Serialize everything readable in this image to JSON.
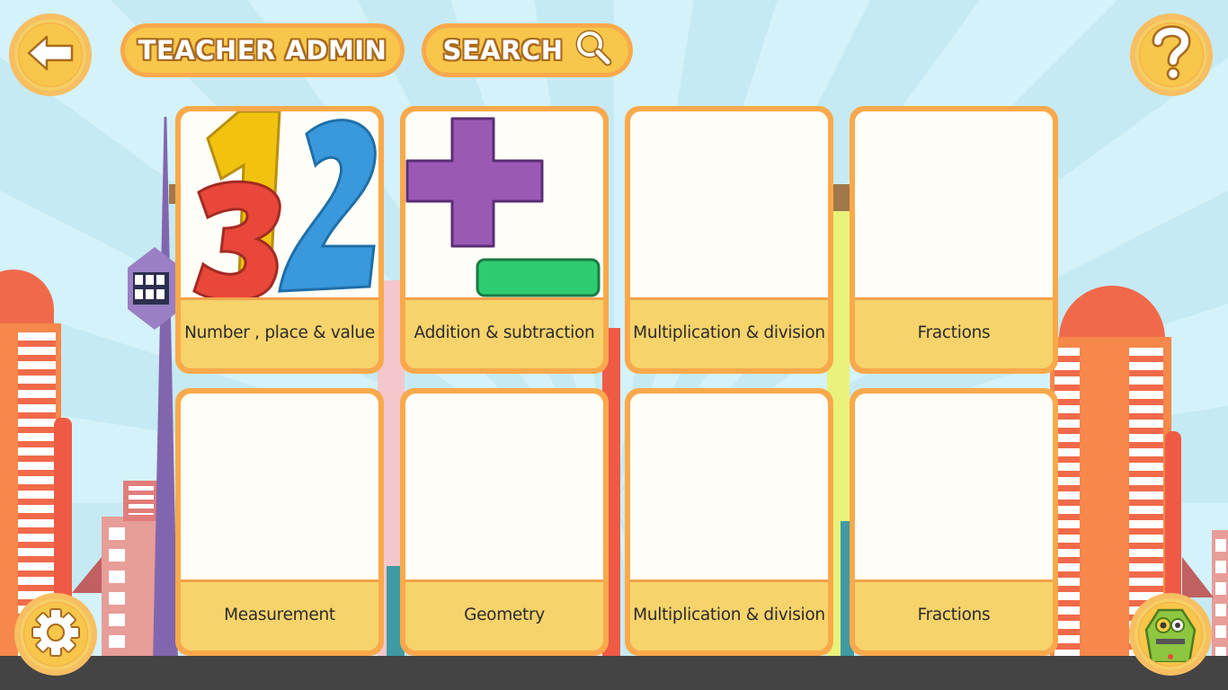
{
  "header": {
    "back_icon": "back-arrow-icon",
    "teacher_admin_label": "TEACHER ADMIN",
    "search_label": "SEARCH",
    "search_icon": "search-icon",
    "help_icon": "question-mark-icon"
  },
  "footer": {
    "settings_icon": "gear-icon",
    "avatar_icon": "green-robot-avatar"
  },
  "cards": [
    {
      "label": "Number , place & value",
      "image": "numbers-123"
    },
    {
      "label": "Addition & subtraction",
      "image": "plus-minus"
    },
    {
      "label": "Multiplication & division",
      "image": ""
    },
    {
      "label": "Fractions",
      "image": ""
    },
    {
      "label": "Measurement",
      "image": ""
    },
    {
      "label": "Geometry",
      "image": ""
    },
    {
      "label": "Multiplication & division",
      "image": ""
    },
    {
      "label": "Fractions",
      "image": ""
    }
  ],
  "colors": {
    "card_border": "#f9a94b",
    "card_label_bg": "#f7d36b",
    "button_fill": "#f7c64a",
    "sky": "#cdeef6",
    "ground": "#444444"
  }
}
